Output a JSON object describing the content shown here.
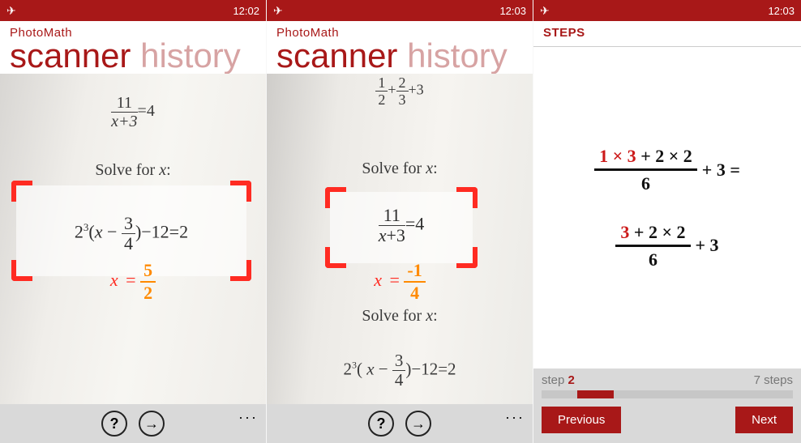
{
  "colors": {
    "brand": "#a81818",
    "accent_red": "#ff2b22",
    "accent_orange": "#ff8a00"
  },
  "screen1": {
    "status_time": "12:02",
    "app_name": "PhotoMath",
    "pivot_active": "scanner",
    "pivot_inactive": "history",
    "paper_eq_top_numer": "11",
    "paper_eq_top_denom": "x+3",
    "paper_eq_top_rhs": "=4",
    "paper_label": "Solve for ",
    "paper_var": "x",
    "paper_label_colon": ":",
    "framed_eq": "2³(x − 3⁄4) − 12 = 2",
    "framed_eq_frac_top": "3",
    "framed_eq_frac_bot": "4",
    "solution_var": "x",
    "solution_eq": " = ",
    "solution_numer": "5",
    "solution_denom": "2",
    "btn_help": "?",
    "btn_next": "→",
    "btn_more": "···"
  },
  "screen2": {
    "status_time": "12:03",
    "app_name": "PhotoMath",
    "pivot_active": "scanner",
    "pivot_inactive": "history",
    "paper_top_a_num": "1",
    "paper_top_a_den": "2",
    "paper_top_b_num": "2",
    "paper_top_b_den": "3",
    "paper_top_plus": "+",
    "paper_top_tail": "+3",
    "paper_label": "Solve for ",
    "paper_var": "x",
    "paper_label_colon": ":",
    "framed_eq_numer": "11",
    "framed_eq_denom_a": "x",
    "framed_eq_denom_b": "+3",
    "framed_eq_rhs": "=4",
    "solution_var": "x",
    "solution_eq": " = ",
    "solution_numer": "-1",
    "solution_denom": "4",
    "paper_label2": "Solve for ",
    "paper_var2": "x",
    "paper_bottom_eq": "2³( x − 3⁄4 )−12=2",
    "paper_bottom_frac_top": "3",
    "paper_bottom_frac_bot": "4",
    "btn_help": "?",
    "btn_next": "→",
    "btn_more": "···"
  },
  "screen3": {
    "status_time": "12:03",
    "title": "STEPS",
    "line1_numerator_parts": [
      "1 × 3",
      " + ",
      "2 × 2"
    ],
    "line1_denom": "6",
    "line1_tail": " + 3 =",
    "line2_numerator_parts": [
      "3",
      " + ",
      "2 × 2"
    ],
    "line2_denom": "6",
    "line2_tail": " + 3",
    "step_label": "step ",
    "current_step": "2",
    "total_steps": "7",
    "steps_label": " steps",
    "btn_prev": "Previous",
    "btn_next": "Next"
  }
}
